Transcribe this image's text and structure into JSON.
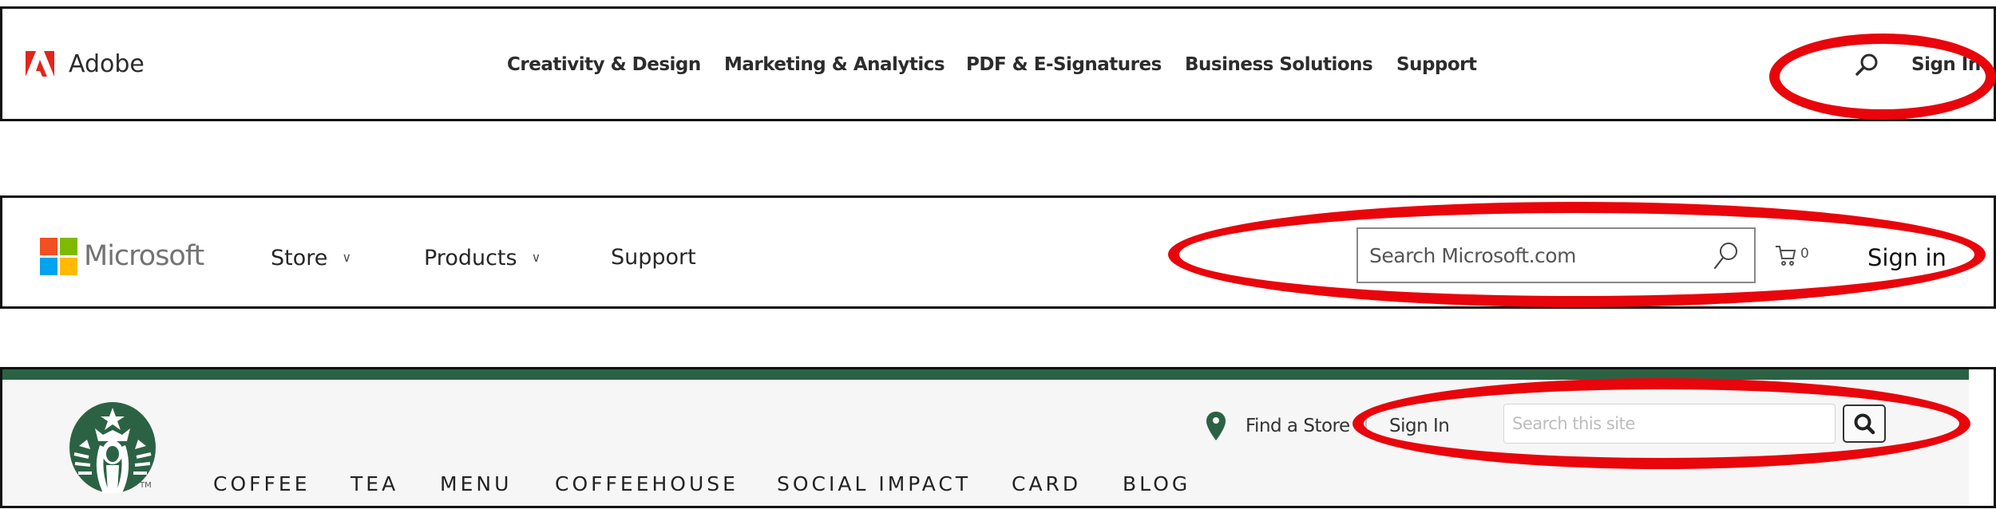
{
  "adobe": {
    "brand": "Adobe",
    "brand_color": "#e1251b",
    "nav": [
      {
        "label": "Creativity & Design"
      },
      {
        "label": "Marketing & Analytics"
      },
      {
        "label": "PDF & E-Signatures"
      },
      {
        "label": "Business Solutions"
      },
      {
        "label": "Support"
      }
    ],
    "search_icon": "search-icon",
    "sign_in": "Sign In"
  },
  "microsoft": {
    "brand": "Microsoft",
    "logo_colors": [
      "#f25022",
      "#7fba00",
      "#00a4ef",
      "#ffb900"
    ],
    "nav": [
      {
        "label": "Store",
        "has_dropdown": true
      },
      {
        "label": "Products",
        "has_dropdown": true
      },
      {
        "label": "Support",
        "has_dropdown": false
      }
    ],
    "chevron": "∨",
    "search": {
      "placeholder": "Search Microsoft.com",
      "value": ""
    },
    "cart_count": "0",
    "sign_in": "Sign in"
  },
  "starbucks": {
    "brand_color": "#2c6244",
    "tm": "TM",
    "nav": [
      {
        "label": "COFFEE"
      },
      {
        "label": "TEA"
      },
      {
        "label": "MENU"
      },
      {
        "label": "COFFEEHOUSE"
      },
      {
        "label": "SOCIAL IMPACT"
      },
      {
        "label": "CARD"
      },
      {
        "label": "BLOG"
      }
    ],
    "find_store": "Find a Store",
    "sign_in": "Sign In",
    "search": {
      "placeholder": "Search this site",
      "value": ""
    }
  },
  "annotation": {
    "highlight_color": "#e8050b"
  }
}
